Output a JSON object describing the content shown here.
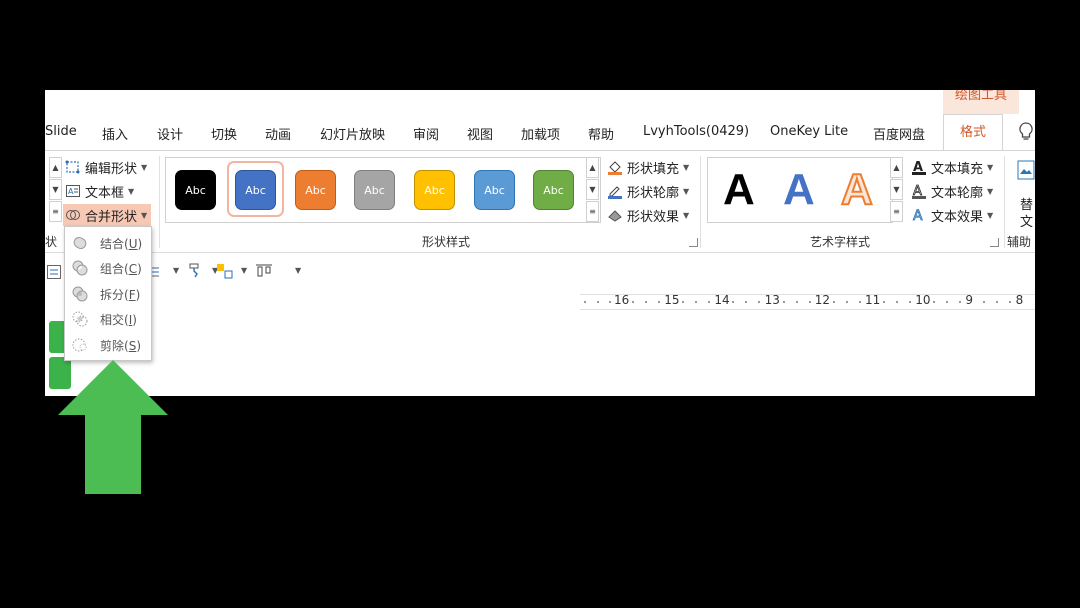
{
  "context_tab_label": "绘图工具",
  "tabs": [
    {
      "label": "Slide",
      "active": false
    },
    {
      "label": "插入",
      "active": false
    },
    {
      "label": "设计",
      "active": false
    },
    {
      "label": "切换",
      "active": false
    },
    {
      "label": "动画",
      "active": false
    },
    {
      "label": "幻灯片放映",
      "active": false
    },
    {
      "label": "审阅",
      "active": false
    },
    {
      "label": "视图",
      "active": false
    },
    {
      "label": "加载项",
      "active": false
    },
    {
      "label": "帮助",
      "active": false
    },
    {
      "label": "LvyhTools(0429)",
      "active": false
    },
    {
      "label": "OneKey Lite",
      "active": false
    },
    {
      "label": "百度网盘",
      "active": false
    },
    {
      "label": "格式",
      "active": true
    }
  ],
  "insert_shapes_group": {
    "edit_shape": "编辑形状",
    "text_box": "文本框",
    "merge_shapes": "合并形状",
    "label_fragment": "状"
  },
  "shape_styles": {
    "group_label": "形状样式",
    "swatch_text": "Abc",
    "swatches": [
      {
        "color": "#000000",
        "selected": false
      },
      {
        "color": "#4472c4",
        "selected": true
      },
      {
        "color": "#ed7d31",
        "selected": false
      },
      {
        "color": "#a5a5a5",
        "selected": false
      },
      {
        "color": "#ffc000",
        "selected": false
      },
      {
        "color": "#5b9bd5",
        "selected": false
      },
      {
        "color": "#70ad47",
        "selected": false
      }
    ],
    "fill": "形状填充",
    "outline": "形状轮廓",
    "effects": "形状效果"
  },
  "wordart_styles": {
    "group_label": "艺术字样式",
    "letter": "A",
    "text_fill": "文本填充",
    "text_outline": "文本轮廓",
    "text_effects": "文本效果"
  },
  "right_edge": {
    "alt_text_top": "替",
    "alt_text_bottom": "文",
    "accessibility_label": "辅助"
  },
  "merge_menu": {
    "items": [
      {
        "label": "结合",
        "key": "U"
      },
      {
        "label": "组合",
        "key": "C"
      },
      {
        "label": "拆分",
        "key": "F"
      },
      {
        "label": "相交",
        "key": "I"
      },
      {
        "label": "剪除",
        "key": "S"
      }
    ]
  },
  "ruler": {
    "numbers": [
      "16",
      "15",
      "14",
      "13",
      "12",
      "11",
      "10",
      "9",
      "8"
    ]
  },
  "accent_color": "#d2592a",
  "arrow_color": "#4cbd52"
}
